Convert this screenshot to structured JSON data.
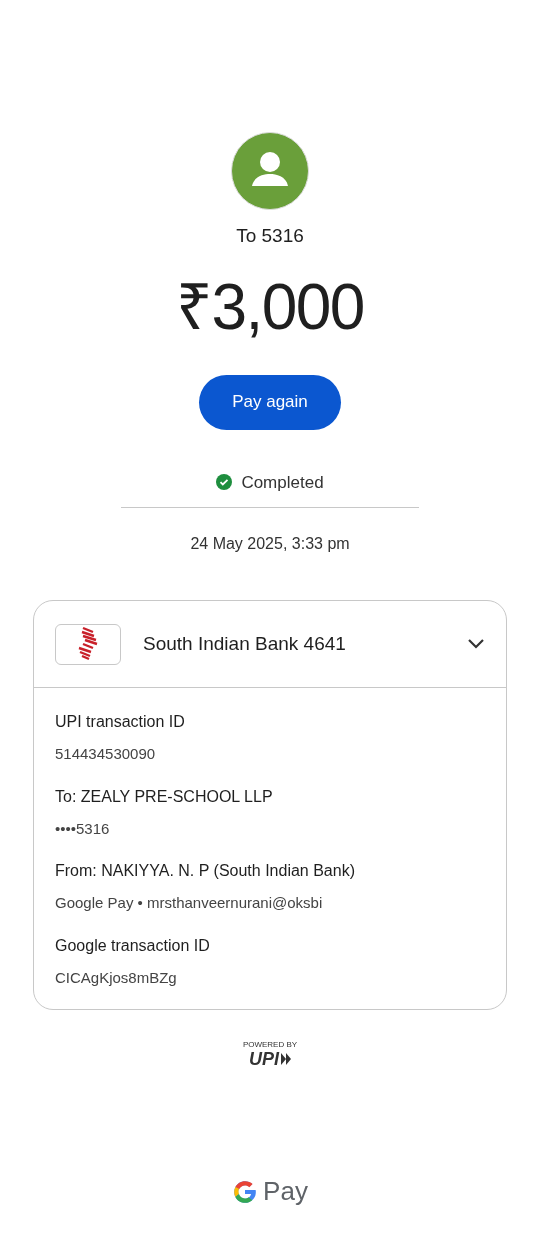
{
  "recipient": {
    "label": "To 5316"
  },
  "amount": "₹3,000",
  "pay_again_button": "Pay again",
  "status": {
    "kind": "completed",
    "label": "Completed"
  },
  "date": "24 May 2025, 3:33 pm",
  "account": {
    "name": "South Indian Bank 4641",
    "expanded": false
  },
  "details": [
    {
      "label": "UPI transaction ID",
      "value": "514434530090"
    },
    {
      "label": "To: ZEALY PRE-SCHOOL LLP",
      "value": "••••5316"
    },
    {
      "label": "From: NAKIYYA. N. P (South Indian Bank)",
      "value": "Google Pay • mrsthanveernurani@oksbi"
    },
    {
      "label": "Google transaction ID",
      "value": "CICAgKjos8mBZg"
    }
  ],
  "upi_badge": {
    "caption": "POWERED BY",
    "logo": "UPI"
  },
  "footer_brand": "Pay"
}
